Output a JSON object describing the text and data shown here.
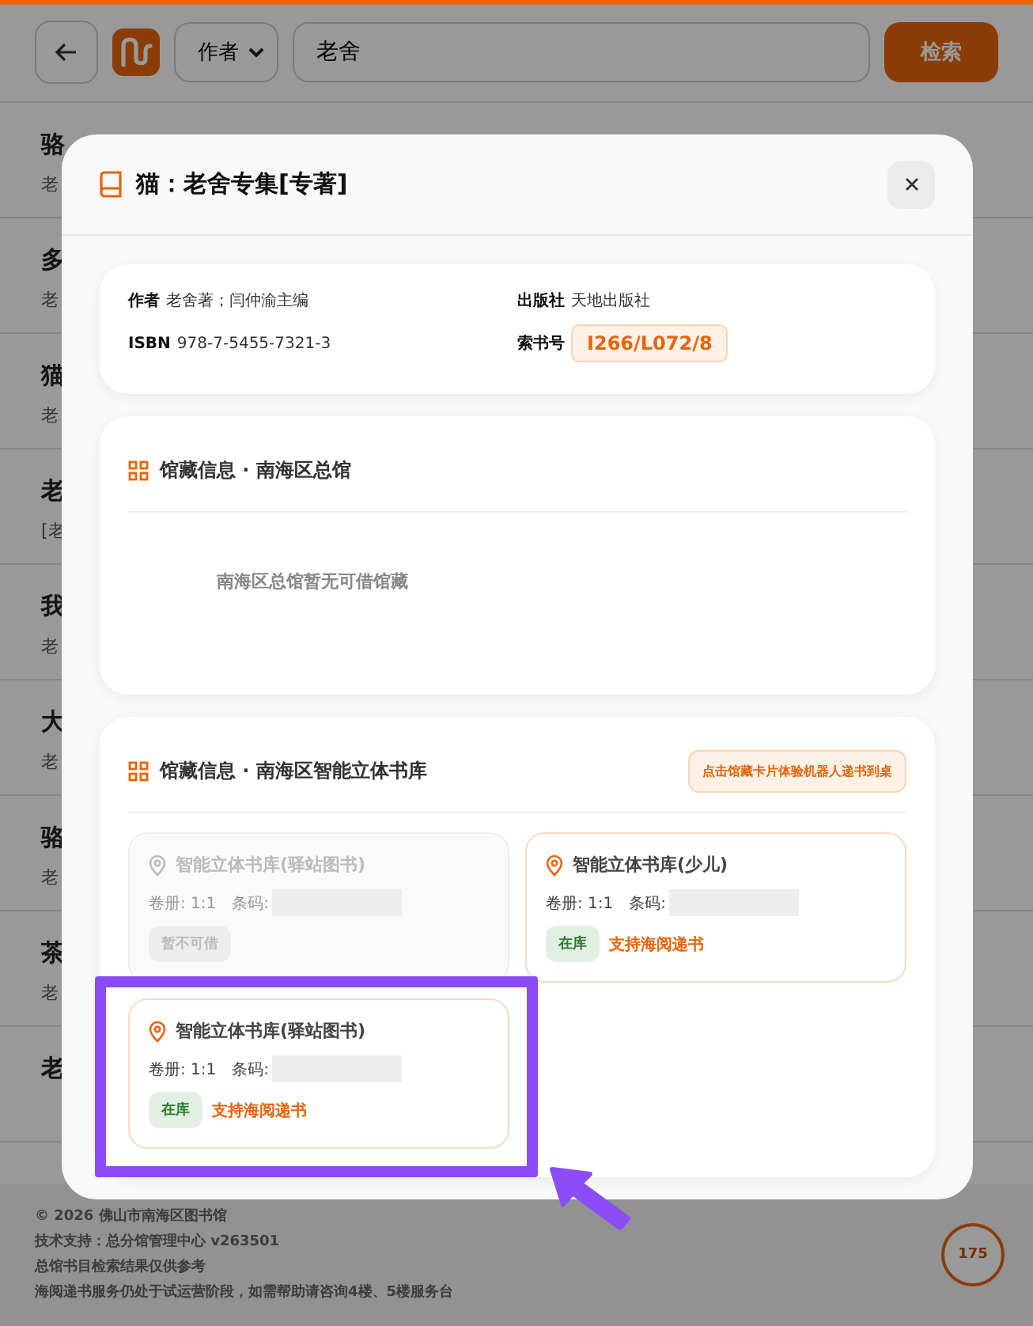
{
  "search_bar": {
    "field_type": "作者",
    "query": "老舍",
    "button": "检索"
  },
  "results": [
    {
      "title": "骆",
      "subtitle": "老"
    },
    {
      "title": "多",
      "subtitle": "老"
    },
    {
      "title": "猫",
      "subtitle": "老"
    },
    {
      "title": "老",
      "subtitle": "[老"
    },
    {
      "title": "我",
      "subtitle": "老"
    },
    {
      "title": "大",
      "subtitle": "老"
    },
    {
      "title": "骆",
      "subtitle": "老"
    },
    {
      "title": "茶",
      "subtitle": "老"
    },
    {
      "title": "老"
    }
  ],
  "footer": {
    "lines": [
      "© 2026 佛山市南海区图书馆",
      "技术支持：总分馆管理中心 v263501",
      "总馆书目检索结果仅供参考",
      "海阅递书服务仍处于试运营阶段，如需帮助请咨询4楼、5楼服务台"
    ],
    "counter": "175"
  },
  "modal": {
    "title": "猫：老舍专集[专著]",
    "details": [
      {
        "label": "作者",
        "value": "老舍著；闫仲渝主编"
      },
      {
        "label": "出版社",
        "value": "天地出版社"
      },
      {
        "label": "ISBN",
        "value": "978-7-5455-7321-3"
      },
      {
        "label": "索书号",
        "value": "I266/L072/8",
        "kind": "callno"
      }
    ],
    "sections": [
      {
        "title": "馆藏信息 · 南海区总馆",
        "empty_text": "南海区总馆暂无可借馆藏"
      },
      {
        "title": "馆藏信息 · 南海区智能立体书库",
        "hint": "点击馆藏卡片体验机器人递书到桌",
        "holdings": [
          {
            "name": "智能立体书库(驿站图书)",
            "volume": "卷册: 1:1",
            "barcode_label": "条码:",
            "status": "暂不可借",
            "available": false,
            "highlighted": false
          },
          {
            "name": "智能立体书库(少儿)",
            "volume": "卷册: 1:1",
            "barcode_label": "条码:",
            "status": "在库",
            "delivery": "支持海阅递书",
            "available": true,
            "highlighted": false
          },
          {
            "name": "智能立体书库(驿站图书)",
            "volume": "卷册: 1:1",
            "barcode_label": "条码:",
            "status": "在库",
            "delivery": "支持海阅递书",
            "available": true,
            "highlighted": true
          }
        ]
      }
    ]
  }
}
